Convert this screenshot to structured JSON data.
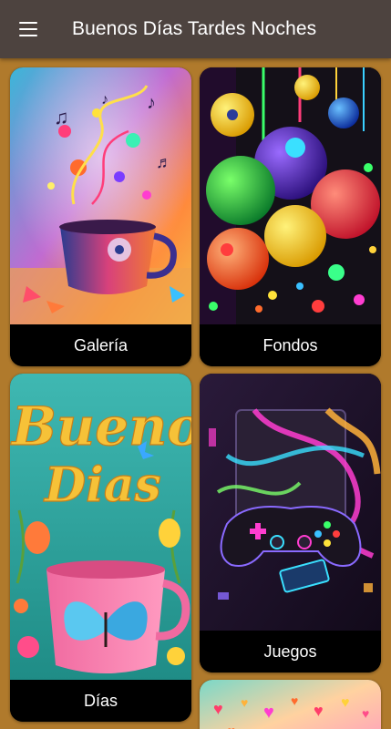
{
  "appbar": {
    "title": "Buenos Días Tardes Noches",
    "menu_icon": "hamburger-menu-icon"
  },
  "cards": [
    {
      "label": "Galería",
      "image": "colorful-music-cup-art"
    },
    {
      "label": "Fondos",
      "image": "colorful-spheres-art"
    },
    {
      "label": "Días",
      "image": "buenos-dias-butterfly-cup-art",
      "art_text": [
        "Buenos",
        "Dias"
      ]
    },
    {
      "label": "Juegos",
      "image": "neon-game-controller-art"
    },
    {
      "label": "",
      "image": "colorful-hearts-art"
    }
  ],
  "colors": {
    "background": "#b07a2c",
    "appbar": "#4d433f",
    "card_label_bg": "#000000"
  }
}
